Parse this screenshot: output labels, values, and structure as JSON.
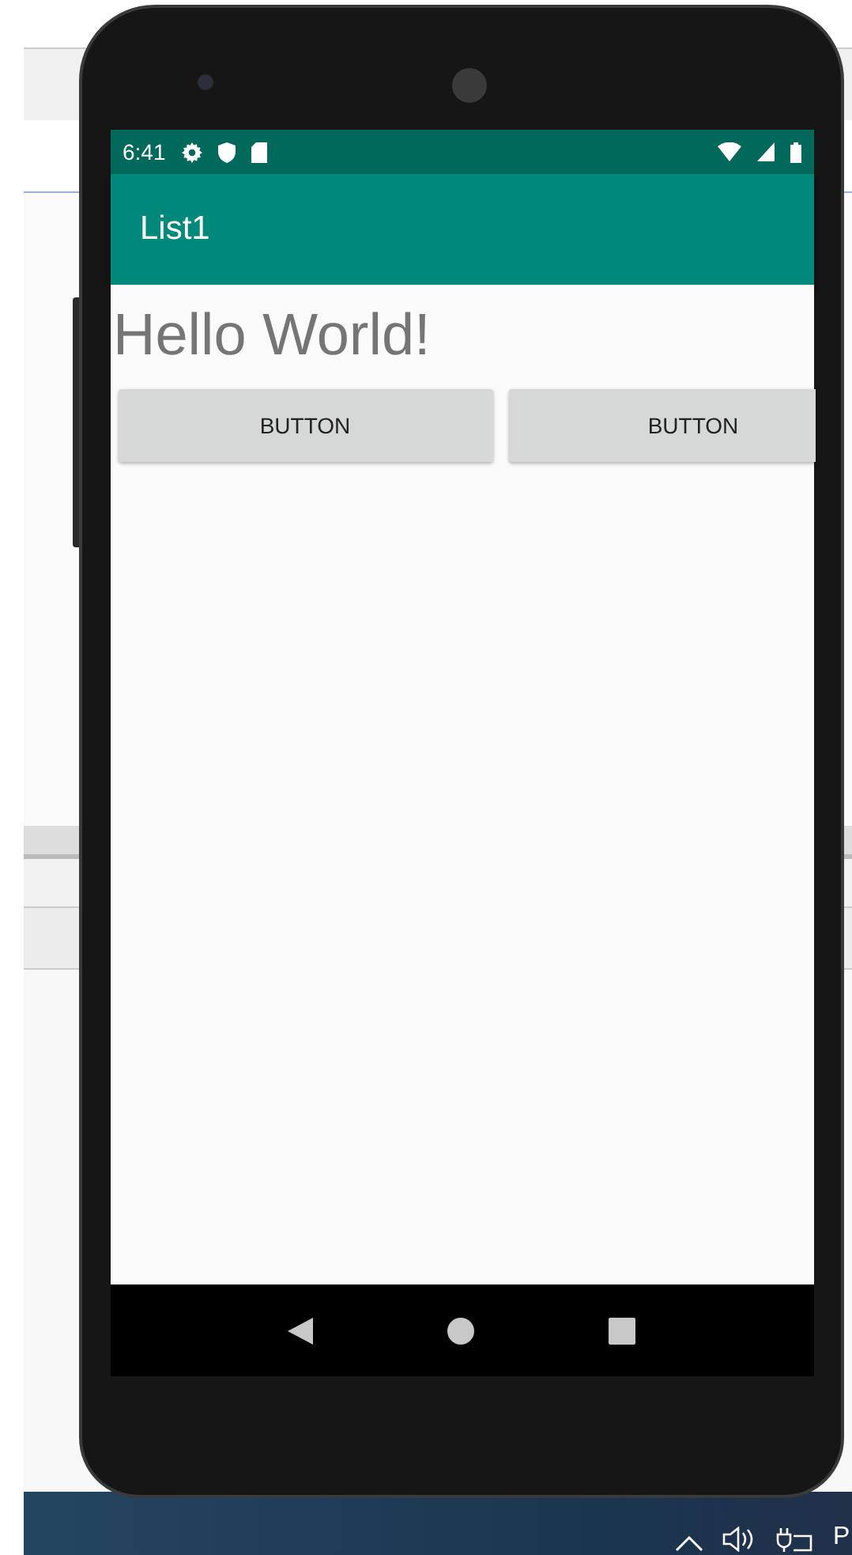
{
  "status_bar": {
    "time": "6:41"
  },
  "app_bar": {
    "title": "List1"
  },
  "content": {
    "text": "Hello World!",
    "buttons": [
      "BUTTON",
      "BUTTON"
    ]
  },
  "taskbar": {
    "tray_text": "Р"
  }
}
